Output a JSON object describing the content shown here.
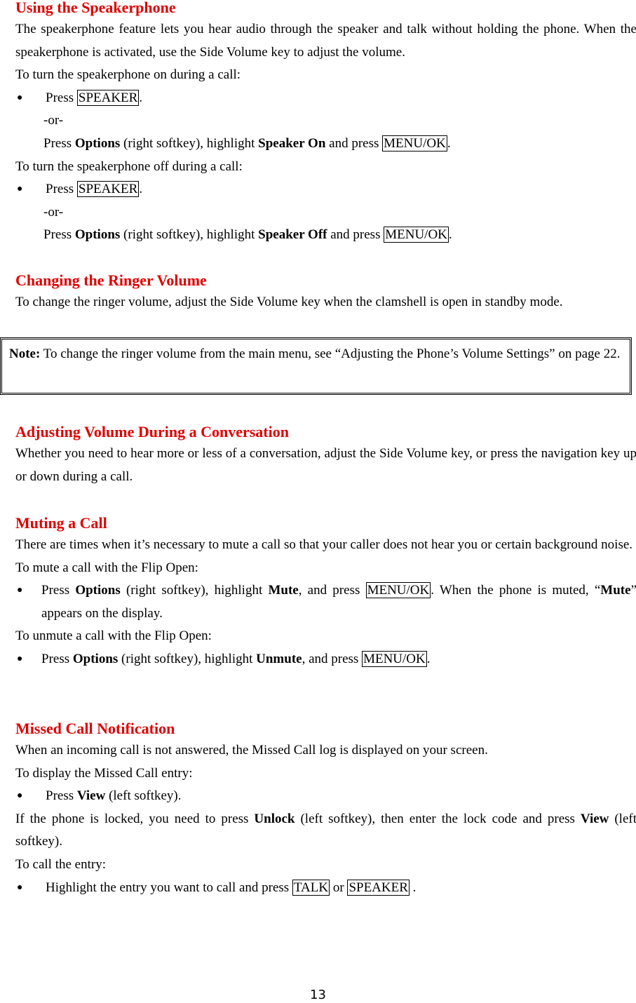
{
  "sections": {
    "speakerphone": {
      "title": "Using the Speakerphone",
      "intro": "The speakerphone feature lets you hear audio through the speaker and talk without holding the phone. When the speakerphone is activated, use the Side Volume key to adjust the volume.",
      "on_label": "To turn the speakerphone on during a call:",
      "on_press": "Press ",
      "speaker_key": "SPEAKER",
      "or": "-or-",
      "opt_press": "Press ",
      "options": "Options",
      "opt_mid": " (right softkey), highlight ",
      "speaker_on": "Speaker On",
      "and_press": " and press ",
      "menu_ok": "MENU/OK",
      "off_label": "To turn the speakerphone off during a call:",
      "speaker_off": "Speaker Off"
    },
    "ringer": {
      "title": "Changing the Ringer Volume",
      "body": "To change the ringer volume, adjust the Side Volume key when the clamshell is open in standby mode.",
      "note_label": "Note:",
      "note_text": " To change the ringer volume from the main menu, see “Adjusting the Phone’s Volume Settings” on page 22."
    },
    "conversation": {
      "title": "Adjusting Volume During a Conversation",
      "body": "Whether you need to hear more or less of a conversation, adjust the Side Volume key, or press the navigation key up or down during a call."
    },
    "muting": {
      "title": "Muting a Call",
      "body": "There are times when it’s necessary to mute a call so that your caller does not hear you or certain background noise.",
      "mute_label": "To mute a call with the Flip Open:",
      "press": "Press ",
      "options": "Options",
      "mid": " (right softkey), highlight ",
      "mute": "Mute",
      "and_press": ", and press ",
      "menu_ok": "MENU/OK",
      "after": ". When the phone is muted, “",
      "after2": "” appears on the display.",
      "unmute_label": "To unmute a call with the Flip Open:",
      "unmute": "Unmute"
    },
    "missed": {
      "title": "Missed Call Notification",
      "body": "When an incoming call is not answered, the Missed Call log is displayed on your screen.",
      "display_label": "To display the Missed Call entry:",
      "press": "Press ",
      "view": "View",
      "left_softkey": " (left softkey).",
      "locked_a": "If the phone is locked, you need to press ",
      "unlock": "Unlock",
      "locked_b": " (left softkey), then enter the lock code and press ",
      "call_label": "To call the entry:",
      "highlight": "Highlight the entry you want to call and press ",
      "talk": "TALK",
      "or": " or ",
      "speaker": "SPEAKER",
      "end": " ."
    }
  },
  "page_number": "13"
}
